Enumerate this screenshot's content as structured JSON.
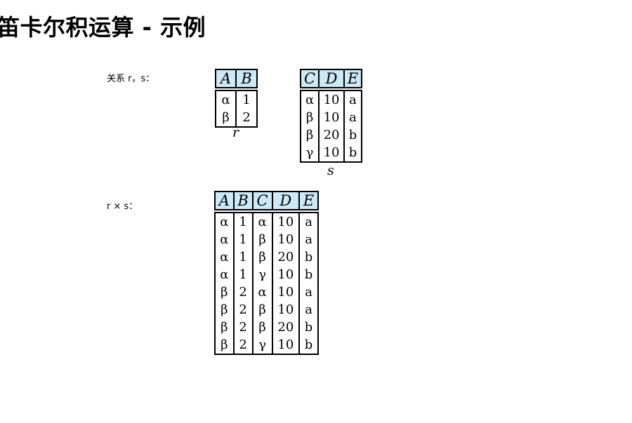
{
  "title": "笛卡尔积运算 - 示例",
  "label_rs": "关系 r，s：",
  "label_product": "r × s：",
  "relation_r": {
    "name": "r",
    "columns": [
      "A",
      "B"
    ],
    "rows": [
      [
        "α",
        "1"
      ],
      [
        "β",
        "2"
      ]
    ]
  },
  "relation_s": {
    "name": "s",
    "columns": [
      "C",
      "D",
      "E"
    ],
    "rows": [
      [
        "α",
        "10",
        "a"
      ],
      [
        "β",
        "10",
        "a"
      ],
      [
        "β",
        "20",
        "b"
      ],
      [
        "γ",
        "10",
        "b"
      ]
    ]
  },
  "relation_product": {
    "columns": [
      "A",
      "B",
      "C",
      "D",
      "E"
    ],
    "rows": [
      [
        "α",
        "1",
        "α",
        "10",
        "a"
      ],
      [
        "α",
        "1",
        "β",
        "10",
        "a"
      ],
      [
        "α",
        "1",
        "β",
        "20",
        "b"
      ],
      [
        "α",
        "1",
        "γ",
        "10",
        "b"
      ],
      [
        "β",
        "2",
        "α",
        "10",
        "a"
      ],
      [
        "β",
        "2",
        "β",
        "10",
        "a"
      ],
      [
        "β",
        "2",
        "β",
        "20",
        "b"
      ],
      [
        "β",
        "2",
        "γ",
        "10",
        "b"
      ]
    ]
  }
}
